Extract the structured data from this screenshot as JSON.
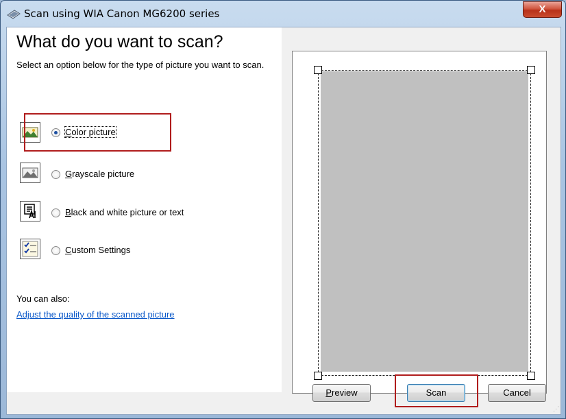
{
  "window": {
    "title": "Scan using WIA Canon MG6200 series",
    "close_glyph": "X",
    "icon": "scanner-icon"
  },
  "left": {
    "heading": "What do you want to scan?",
    "subtitle": "Select an option below for the type of picture you want to scan.",
    "options": [
      {
        "access_key": "C",
        "rest": "olor picture",
        "icon": "color-picture-icon",
        "selected": true
      },
      {
        "access_key": "G",
        "rest": "rayscale picture",
        "icon": "grayscale-picture-icon",
        "selected": false
      },
      {
        "access_key": "B",
        "rest": "lack and white picture or text",
        "icon": "bw-text-icon",
        "selected": false
      },
      {
        "access_key": "C",
        "rest": "ustom Settings",
        "icon": "custom-settings-icon",
        "selected": false
      }
    ],
    "also_label": "You can also:",
    "adjust_link": "Adjust the quality of the scanned picture"
  },
  "buttons": {
    "preview_key": "P",
    "preview_rest": "review",
    "scan": "Scan",
    "cancel": "Cancel"
  },
  "colors": {
    "highlight": "#b01c1c",
    "link": "#0a58c9",
    "scan_area": "#c0c0c0"
  }
}
